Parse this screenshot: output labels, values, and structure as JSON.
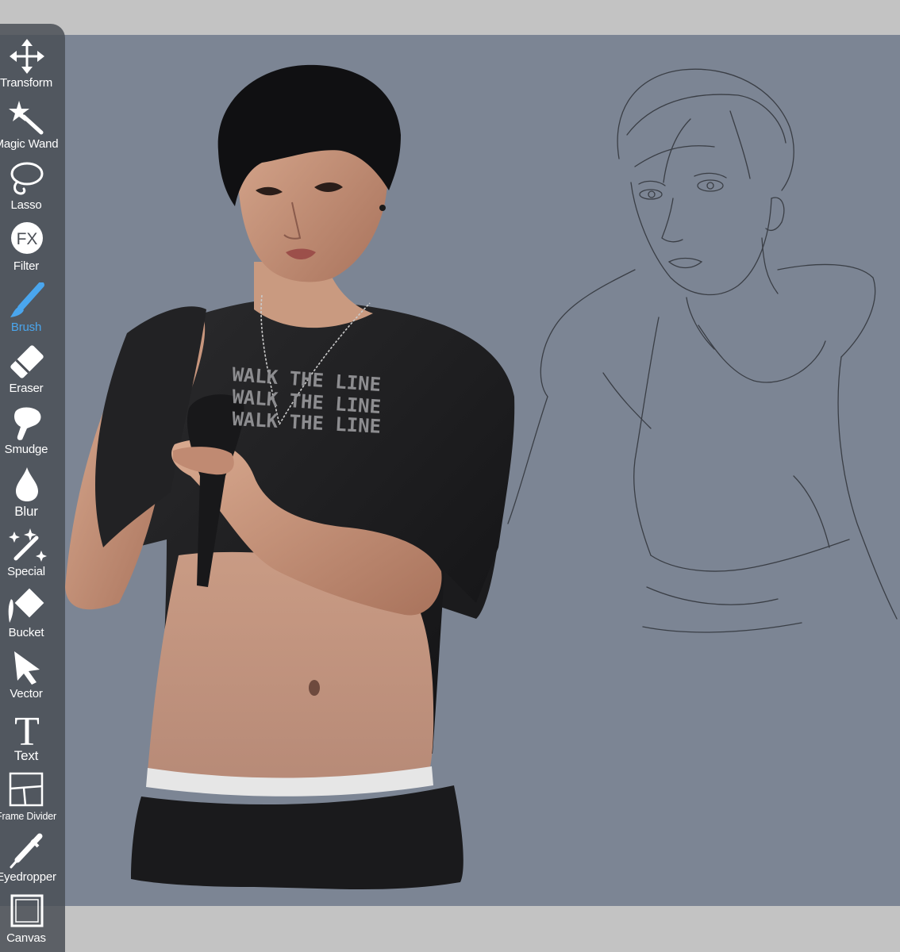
{
  "app": {
    "accent_color": "#4aa6ee",
    "toolbar_bg": "#4b4f56",
    "canvas_bg": "#7c8594"
  },
  "toolbar": {
    "active_tool": "Brush",
    "tools": [
      {
        "label": "Transform",
        "icon": "move-arrows-icon"
      },
      {
        "label": "Magic Wand",
        "icon": "magic-wand-icon"
      },
      {
        "label": "Lasso",
        "icon": "lasso-icon"
      },
      {
        "label": "Filter",
        "icon": "fx-filter-icon"
      },
      {
        "label": "Brush",
        "icon": "brush-icon"
      },
      {
        "label": "Eraser",
        "icon": "eraser-icon"
      },
      {
        "label": "Smudge",
        "icon": "smudge-finger-icon"
      },
      {
        "label": "Blur",
        "icon": "blur-drop-icon"
      },
      {
        "label": "Special",
        "icon": "special-sparkle-pen-icon"
      },
      {
        "label": "Bucket",
        "icon": "bucket-fill-icon"
      },
      {
        "label": "Vector",
        "icon": "vector-cursor-icon"
      },
      {
        "label": "Text",
        "icon": "text-t-icon"
      },
      {
        "label": "Frame Divider",
        "icon": "frame-divider-icon"
      },
      {
        "label": "Eyedropper",
        "icon": "eyedropper-icon"
      },
      {
        "label": "Canvas",
        "icon": "canvas-square-icon"
      }
    ]
  },
  "canvas": {
    "shirt_text": [
      "WALK THE LINE",
      "WALK THE LINE",
      "WALK THE LINE"
    ]
  }
}
